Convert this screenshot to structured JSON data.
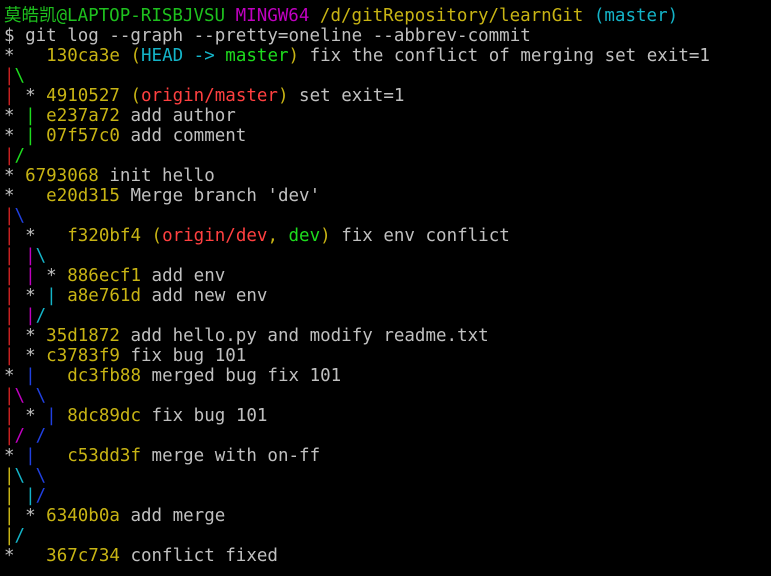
{
  "colors": {
    "default": "#c0c0c0",
    "green": "#1ec11e",
    "magenta": "#c000c0",
    "yellow": "#c8b414",
    "cyan": "#14b4c8",
    "red": "#c82020",
    "bright_green": "#1edc1e",
    "blue": "#2040e0",
    "bright_red": "#ff4040"
  },
  "terminal": {
    "lines": [
      [
        {
          "text": "莫皓凯@LAPTOP-RISBJVSU ",
          "color": "green"
        },
        {
          "text": "MINGW64 ",
          "color": "magenta"
        },
        {
          "text": "/d/gitRepository/learnGit ",
          "color": "yellow"
        },
        {
          "text": "(master)",
          "color": "cyan"
        }
      ],
      [
        {
          "text": "$ git log --graph --pretty=oneline --abbrev-commit",
          "color": "default"
        }
      ],
      [
        {
          "text": "*   ",
          "color": "default"
        },
        {
          "text": "130ca3e ",
          "color": "yellow"
        },
        {
          "text": "(",
          "color": "yellow"
        },
        {
          "text": "HEAD -> ",
          "color": "cyan"
        },
        {
          "text": "master",
          "color": "bright_green"
        },
        {
          "text": ")",
          "color": "yellow"
        },
        {
          "text": " fix the conflict of merging set exit=1",
          "color": "default"
        }
      ],
      [
        {
          "text": "|",
          "color": "red"
        },
        {
          "text": "\\",
          "color": "bright_green"
        }
      ],
      [
        {
          "text": "| ",
          "color": "red"
        },
        {
          "text": "* ",
          "color": "default"
        },
        {
          "text": "4910527 ",
          "color": "yellow"
        },
        {
          "text": "(",
          "color": "yellow"
        },
        {
          "text": "origin/master",
          "color": "bright_red"
        },
        {
          "text": ")",
          "color": "yellow"
        },
        {
          "text": " set exit=1",
          "color": "default"
        }
      ],
      [
        {
          "text": "* ",
          "color": "default"
        },
        {
          "text": "| ",
          "color": "bright_green"
        },
        {
          "text": "e237a72 ",
          "color": "yellow"
        },
        {
          "text": "add author",
          "color": "default"
        }
      ],
      [
        {
          "text": "* ",
          "color": "default"
        },
        {
          "text": "| ",
          "color": "bright_green"
        },
        {
          "text": "07f57c0 ",
          "color": "yellow"
        },
        {
          "text": "add comment",
          "color": "default"
        }
      ],
      [
        {
          "text": "|",
          "color": "red"
        },
        {
          "text": "/",
          "color": "bright_green"
        }
      ],
      [
        {
          "text": "* ",
          "color": "default"
        },
        {
          "text": "6793068 ",
          "color": "yellow"
        },
        {
          "text": "init hello",
          "color": "default"
        }
      ],
      [
        {
          "text": "*   ",
          "color": "default"
        },
        {
          "text": "e20d315 ",
          "color": "yellow"
        },
        {
          "text": "Merge branch 'dev'",
          "color": "default"
        }
      ],
      [
        {
          "text": "|",
          "color": "red"
        },
        {
          "text": "\\",
          "color": "blue"
        }
      ],
      [
        {
          "text": "| ",
          "color": "red"
        },
        {
          "text": "*   ",
          "color": "default"
        },
        {
          "text": "f320bf4 ",
          "color": "yellow"
        },
        {
          "text": "(",
          "color": "yellow"
        },
        {
          "text": "origin/dev",
          "color": "bright_red"
        },
        {
          "text": ", ",
          "color": "yellow"
        },
        {
          "text": "dev",
          "color": "bright_green"
        },
        {
          "text": ")",
          "color": "yellow"
        },
        {
          "text": " fix env conflict",
          "color": "default"
        }
      ],
      [
        {
          "text": "| ",
          "color": "red"
        },
        {
          "text": "|",
          "color": "magenta"
        },
        {
          "text": "\\",
          "color": "cyan"
        }
      ],
      [
        {
          "text": "| ",
          "color": "red"
        },
        {
          "text": "| ",
          "color": "magenta"
        },
        {
          "text": "* ",
          "color": "default"
        },
        {
          "text": "886ecf1 ",
          "color": "yellow"
        },
        {
          "text": "add env",
          "color": "default"
        }
      ],
      [
        {
          "text": "| ",
          "color": "red"
        },
        {
          "text": "* ",
          "color": "default"
        },
        {
          "text": "| ",
          "color": "cyan"
        },
        {
          "text": "a8e761d ",
          "color": "yellow"
        },
        {
          "text": "add new env",
          "color": "default"
        }
      ],
      [
        {
          "text": "| ",
          "color": "red"
        },
        {
          "text": "|",
          "color": "magenta"
        },
        {
          "text": "/",
          "color": "cyan"
        }
      ],
      [
        {
          "text": "| ",
          "color": "red"
        },
        {
          "text": "* ",
          "color": "default"
        },
        {
          "text": "35d1872 ",
          "color": "yellow"
        },
        {
          "text": "add hello.py and modify readme.txt",
          "color": "default"
        }
      ],
      [
        {
          "text": "| ",
          "color": "red"
        },
        {
          "text": "* ",
          "color": "default"
        },
        {
          "text": "c3783f9 ",
          "color": "yellow"
        },
        {
          "text": "fix bug 101",
          "color": "default"
        }
      ],
      [
        {
          "text": "* ",
          "color": "default"
        },
        {
          "text": "|   ",
          "color": "blue"
        },
        {
          "text": "dc3fb88 ",
          "color": "yellow"
        },
        {
          "text": "merged bug fix 101",
          "color": "default"
        }
      ],
      [
        {
          "text": "|",
          "color": "red"
        },
        {
          "text": "\\ ",
          "color": "magenta"
        },
        {
          "text": "\\",
          "color": "blue"
        }
      ],
      [
        {
          "text": "| ",
          "color": "red"
        },
        {
          "text": "* ",
          "color": "default"
        },
        {
          "text": "| ",
          "color": "blue"
        },
        {
          "text": "8dc89dc ",
          "color": "yellow"
        },
        {
          "text": "fix bug 101",
          "color": "default"
        }
      ],
      [
        {
          "text": "|",
          "color": "red"
        },
        {
          "text": "/ ",
          "color": "magenta"
        },
        {
          "text": "/",
          "color": "blue"
        }
      ],
      [
        {
          "text": "* ",
          "color": "default"
        },
        {
          "text": "|   ",
          "color": "blue"
        },
        {
          "text": "c53dd3f ",
          "color": "yellow"
        },
        {
          "text": "merge with on-ff",
          "color": "default"
        }
      ],
      [
        {
          "text": "|",
          "color": "yellow"
        },
        {
          "text": "\\ ",
          "color": "cyan"
        },
        {
          "text": "\\",
          "color": "blue"
        }
      ],
      [
        {
          "text": "| ",
          "color": "yellow"
        },
        {
          "text": "|",
          "color": "cyan"
        },
        {
          "text": "/",
          "color": "blue"
        }
      ],
      [
        {
          "text": "| ",
          "color": "yellow"
        },
        {
          "text": "* ",
          "color": "default"
        },
        {
          "text": "6340b0a ",
          "color": "yellow"
        },
        {
          "text": "add merge",
          "color": "default"
        }
      ],
      [
        {
          "text": "|",
          "color": "yellow"
        },
        {
          "text": "/",
          "color": "cyan"
        }
      ],
      [
        {
          "text": "*   ",
          "color": "default"
        },
        {
          "text": "367c734 ",
          "color": "yellow"
        },
        {
          "text": "conflict fixed",
          "color": "default"
        }
      ]
    ]
  }
}
